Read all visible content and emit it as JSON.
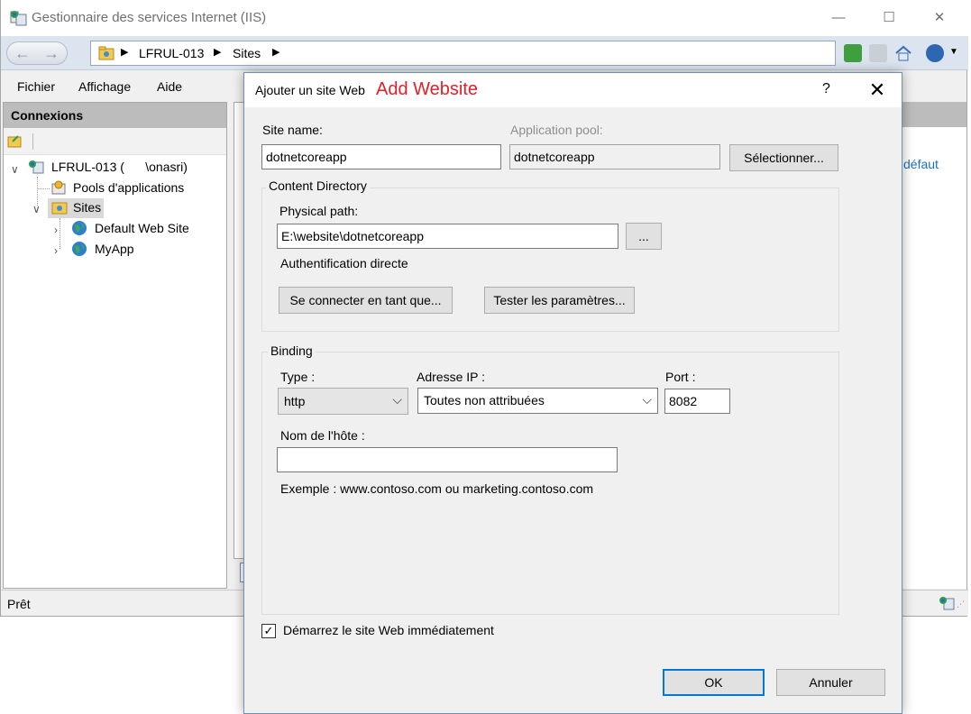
{
  "window": {
    "title": "Gestionnaire des services Internet (IIS)",
    "minimize": "—",
    "maximize": "☐",
    "close": "✕"
  },
  "nav": {
    "back": "←",
    "forward": "→",
    "breadcrumb": [
      "LFRUL-013",
      "Sites"
    ],
    "separator": "▶"
  },
  "menu": [
    "Fichier",
    "Affichage",
    "Aide"
  ],
  "connections": {
    "title": "Connexions",
    "server": "LFRUL-013 (      \\onasri)",
    "app_pools": "Pools d'applications",
    "sites": "Sites",
    "site_items": [
      "Default Web Site",
      "MyApp"
    ]
  },
  "actions": {
    "link_fragment": "défaut"
  },
  "status": {
    "text": "Prêt"
  },
  "dialog": {
    "title": "Ajouter un site Web",
    "title_accent": "Add Website",
    "help": "?",
    "close": "✕",
    "site_name_label": "Site name:",
    "site_name_value": "dotnetcoreapp",
    "app_pool_label": "Application pool:",
    "app_pool_value": "dotnetcoreapp",
    "select_button": "Sélectionner...",
    "content_group": "Content Directory",
    "physical_path_label": "Physical path:",
    "physical_path_value": "E:\\website\\dotnetcoreapp",
    "browse_button": "...",
    "auth_text": "Authentification directe",
    "connect_as_button": "Se connecter en tant que...",
    "test_settings_button": "Tester les paramètres...",
    "binding_group": "Binding",
    "type_label": "Type :",
    "type_value": "http",
    "ip_label": "Adresse IP :",
    "ip_value": "Toutes non attribuées",
    "port_label": "Port :",
    "port_value": "8082",
    "host_label": "Nom de l'hôte :",
    "host_value": "",
    "example_text": "Exemple : www.contoso.com ou marketing.contoso.com",
    "start_checkbox_checked": true,
    "start_checkbox_label": "Démarrez le site Web immédiatement",
    "ok_button": "OK",
    "cancel_button": "Annuler"
  },
  "colors": {
    "accent_title": "#e1202a",
    "default_button_border": "#0078d7",
    "link": "#1c6fbf"
  }
}
